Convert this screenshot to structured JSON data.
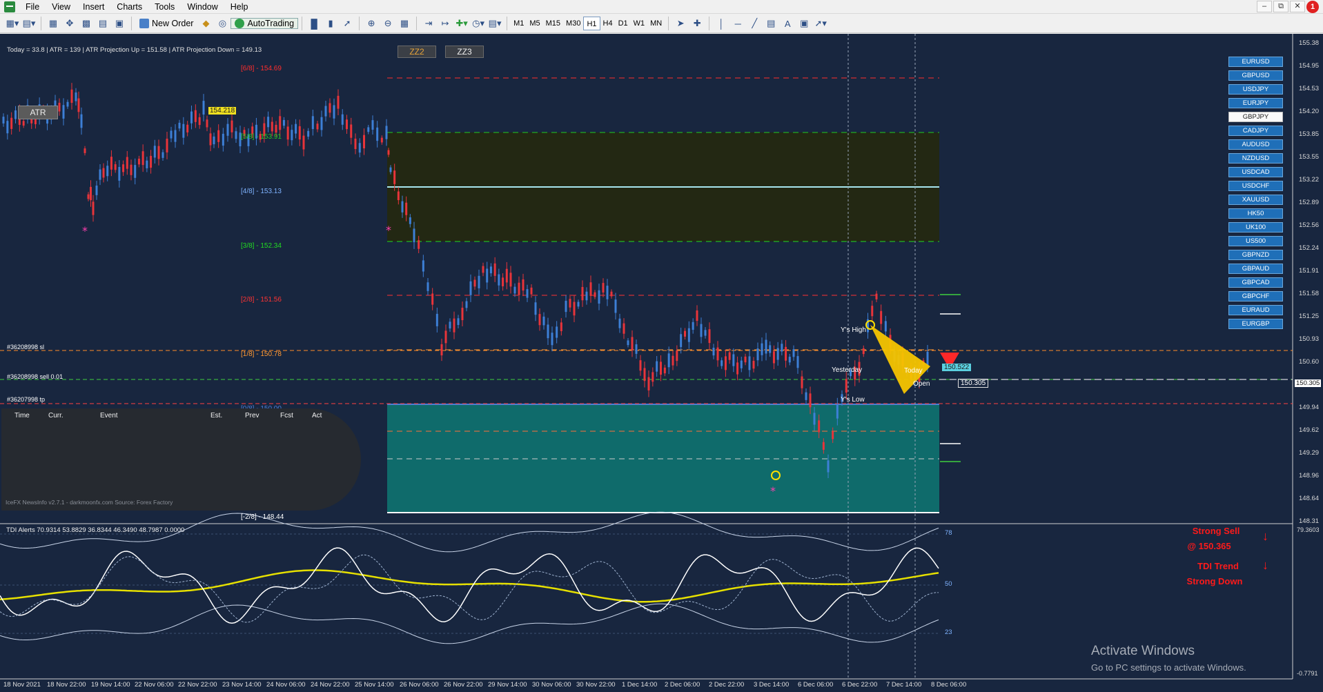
{
  "menu": {
    "items": [
      "File",
      "View",
      "Insert",
      "Charts",
      "Tools",
      "Window",
      "Help"
    ]
  },
  "notifications": {
    "count": "1"
  },
  "toolbar": {
    "new_order": "New Order",
    "auto_trading": "AutoTrading",
    "timeframes": [
      "M1",
      "M5",
      "M15",
      "M30",
      "H1",
      "H4",
      "D1",
      "W1",
      "MN"
    ],
    "active_timeframe": "H1"
  },
  "chart": {
    "info_line": "Today = 33.8   |   ATR = 139   |   ATR Projection Up = 151.58   |   ATR Projection Down = 149.13",
    "zz_buttons": [
      "ZZ2",
      "ZZ3"
    ],
    "atr_button": "ATR",
    "symbols": [
      "EURUSD",
      "GBPUSD",
      "USDJPY",
      "EURJPY",
      "GBPJPY",
      "CADJPY",
      "AUDUSD",
      "NZDUSD",
      "USDCAD",
      "USDCHF",
      "XAUUSD",
      "HK50",
      "UK100",
      "US500",
      "GBPNZD",
      "GBPAUD",
      "GBPCAD",
      "GBPCHF",
      "EURAUD",
      "EURGBP"
    ],
    "active_symbol": "GBPJPY",
    "price_axis": [
      "155.38",
      "154.95",
      "154.53",
      "154.20",
      "153.85",
      "153.55",
      "153.22",
      "152.89",
      "152.56",
      "152.24",
      "151.91",
      "151.58",
      "151.25",
      "150.93",
      "150.60",
      "150.305",
      "149.94",
      "149.62",
      "149.29",
      "148.96",
      "148.64",
      "148.31"
    ],
    "current_price": "150.305",
    "murrey_levels": [
      {
        "label": "[6/8] - 154.69",
        "color": "#ff2d2d"
      },
      {
        "label": "[5/8] - 153.91",
        "color": "#22cc22"
      },
      {
        "label": "[4/8] - 153.13",
        "color": "#7fb3ff"
      },
      {
        "label": "[3/8] - 152.34",
        "color": "#22dd22"
      },
      {
        "label": "[2/8] - 151.56",
        "color": "#ff3333"
      },
      {
        "label": "[1/8] - 150.78",
        "color": "#ff9933"
      },
      {
        "label": "[0/8] - 150.00",
        "color": "#4a7fd8"
      },
      {
        "label": "[-2/8] - 148.44",
        "color": "#ffffff"
      }
    ],
    "high_marker": "154.218",
    "day_labels": {
      "ys_high": "Y's High",
      "yesterday": "Yesterday",
      "ys_low": "Y's Low",
      "today": "Today",
      "open": "Open"
    },
    "price_tags": {
      "upper": "150.522",
      "lower": "150.305"
    },
    "orders": [
      {
        "label": "#36208998 sl"
      },
      {
        "label": "#36208998 sell 0.01"
      },
      {
        "label": "#36207998 tp"
      }
    ],
    "time_axis": [
      "18 Nov 2021",
      "18 Nov 22:00",
      "19 Nov 14:00",
      "22 Nov 06:00",
      "22 Nov 22:00",
      "23 Nov 14:00",
      "24 Nov 06:00",
      "24 Nov 22:00",
      "25 Nov 14:00",
      "26 Nov 06:00",
      "26 Nov 22:00",
      "29 Nov 14:00",
      "30 Nov 06:00",
      "30 Nov 22:00",
      "1 Dec 14:00",
      "2 Dec 06:00",
      "2 Dec 22:00",
      "3 Dec 14:00",
      "6 Dec 06:00",
      "6 Dec 22:00",
      "7 Dec 14:00",
      "8 Dec 06:00"
    ]
  },
  "news": {
    "headers": [
      "Time",
      "Curr.",
      "Event",
      "Est.",
      "Prev",
      "Fcst",
      "Act"
    ],
    "footer": "IceFX NewsInfo v2.7.1  -  darkmoonfx.com          Source: Forex Factory"
  },
  "tdi": {
    "label": "TDI Alerts  70.9314 53.8829 36.8344 46.3490 48.7987 0.0000",
    "levels": [
      "78",
      "50",
      "23"
    ],
    "axis_top": "79.3603",
    "axis_bottom": "-0.7791",
    "signal_sell": "Strong Sell",
    "signal_price": "@ 150.365",
    "trend_line1": "TDI Trend",
    "trend_line2": "Strong Down"
  },
  "watermark": {
    "title": "Activate Windows",
    "subtitle": "Go to PC settings to activate Windows."
  },
  "colors": {
    "background": "#18263f",
    "bull_candle": "#3d7fd6",
    "bear_candle": "#e8343a",
    "upper_zone": "#232813",
    "lower_zone": "#0f6b6b",
    "tdi_yellow": "#e6e000"
  }
}
